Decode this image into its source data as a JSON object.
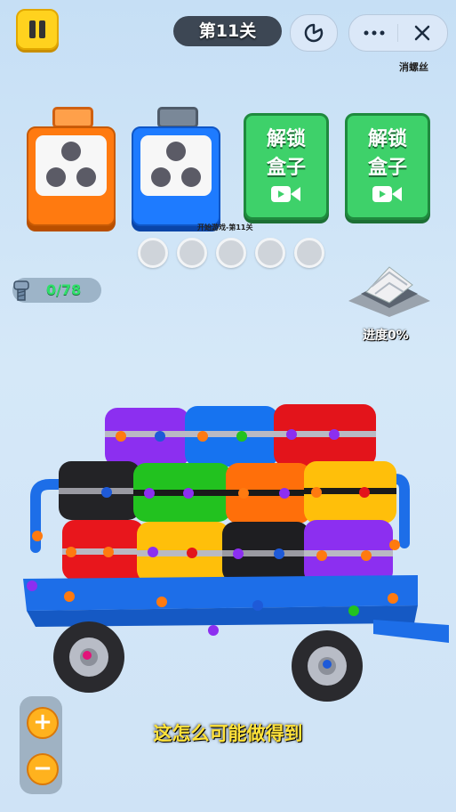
{
  "header": {
    "level_title": "第11关",
    "remove_screws_label": "消螺丝"
  },
  "boxes": {
    "unlock_1": {
      "line1": "解锁",
      "line2": "盒子"
    },
    "unlock_2": {
      "line1": "解锁",
      "line2": "盒子"
    },
    "start_caption": "开始游戏-第11关",
    "colors": {
      "orange": "#ff7a10",
      "blue": "#1e7bff",
      "green": "#3ed16a"
    }
  },
  "progress": {
    "screw_count": "0/78",
    "progress_label": "进度0%"
  },
  "subtitle": "这怎么可能做得到",
  "zoom": {
    "plus": "+",
    "minus": "−"
  }
}
